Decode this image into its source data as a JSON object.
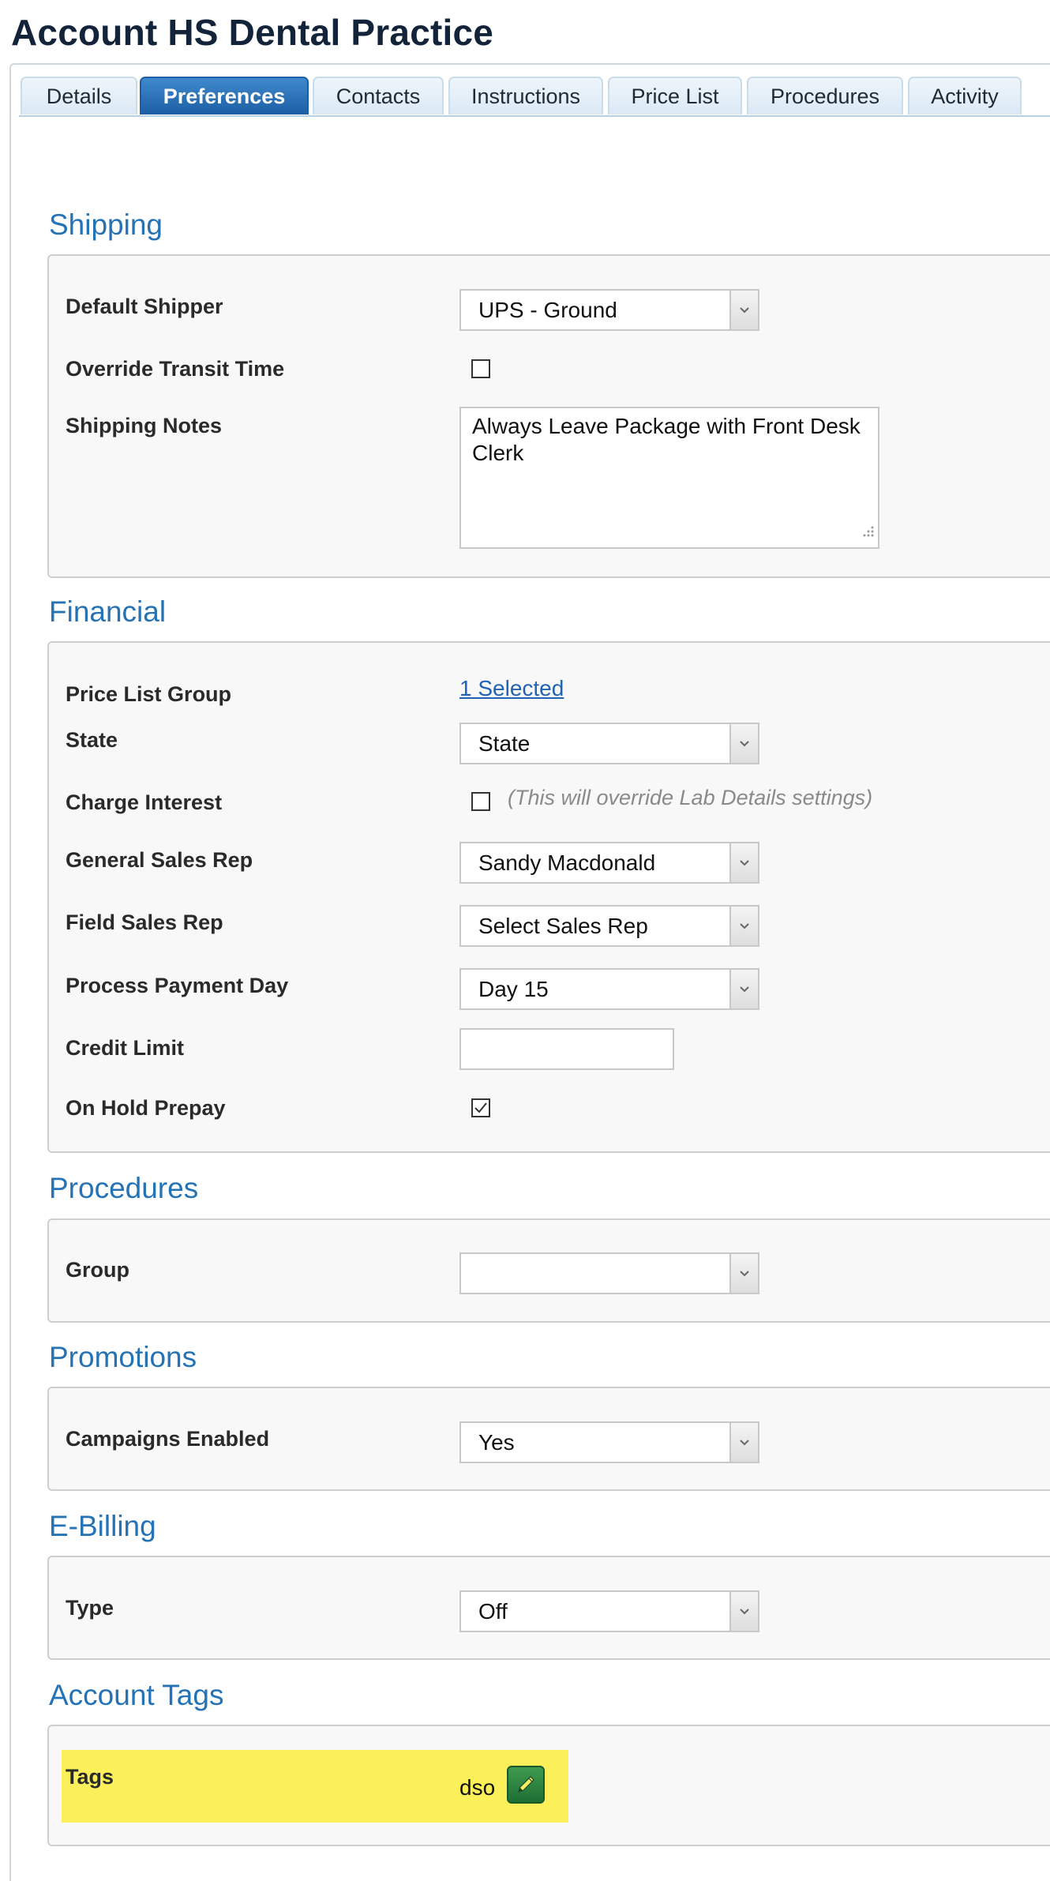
{
  "page": {
    "title": "Account HS Dental Practice"
  },
  "tabs": [
    {
      "label": "Details"
    },
    {
      "label": "Preferences",
      "active": true
    },
    {
      "label": "Contacts"
    },
    {
      "label": "Instructions"
    },
    {
      "label": "Price List"
    },
    {
      "label": "Procedures"
    },
    {
      "label": "Activity"
    }
  ],
  "shipping": {
    "title": "Shipping",
    "default_shipper": {
      "label": "Default Shipper",
      "value": "UPS - Ground"
    },
    "override_transit": {
      "label": "Override Transit Time",
      "checked": false
    },
    "notes": {
      "label": "Shipping Notes",
      "value": "Always Leave Package with Front Desk Clerk"
    }
  },
  "financial": {
    "title": "Financial",
    "price_list_group": {
      "label": "Price List Group",
      "link": "1 Selected"
    },
    "state": {
      "label": "State",
      "value": "State"
    },
    "charge_interest": {
      "label": "Charge Interest",
      "checked": false,
      "note": "(This will override Lab Details settings)"
    },
    "general_sales_rep": {
      "label": "General Sales Rep",
      "value": "Sandy Macdonald"
    },
    "field_sales_rep": {
      "label": "Field Sales Rep",
      "value": "Select Sales Rep"
    },
    "process_payment_day": {
      "label": "Process Payment Day",
      "value": "Day 15"
    },
    "credit_limit": {
      "label": "Credit Limit",
      "value": ""
    },
    "on_hold_prepay": {
      "label": "On Hold Prepay",
      "checked": true
    }
  },
  "procedures": {
    "title": "Procedures",
    "group": {
      "label": "Group",
      "value": ""
    }
  },
  "promotions": {
    "title": "Promotions",
    "campaigns_enabled": {
      "label": "Campaigns Enabled",
      "value": "Yes"
    }
  },
  "ebilling": {
    "title": "E-Billing",
    "type": {
      "label": "Type",
      "value": "Off"
    }
  },
  "account_tags": {
    "title": "Account Tags",
    "tags": {
      "label": "Tags",
      "value": "dso",
      "highlight_color": "#fbf05a"
    }
  },
  "colors": {
    "accent": "#2573b5",
    "active_tab": "#1c5ea4",
    "edit_button": "#2e8540"
  },
  "icons": {
    "select_arrow": "chevron-down-icon",
    "edit": "pencil-icon",
    "checked": "checkmark-icon",
    "resize": "resize-grip-icon"
  }
}
